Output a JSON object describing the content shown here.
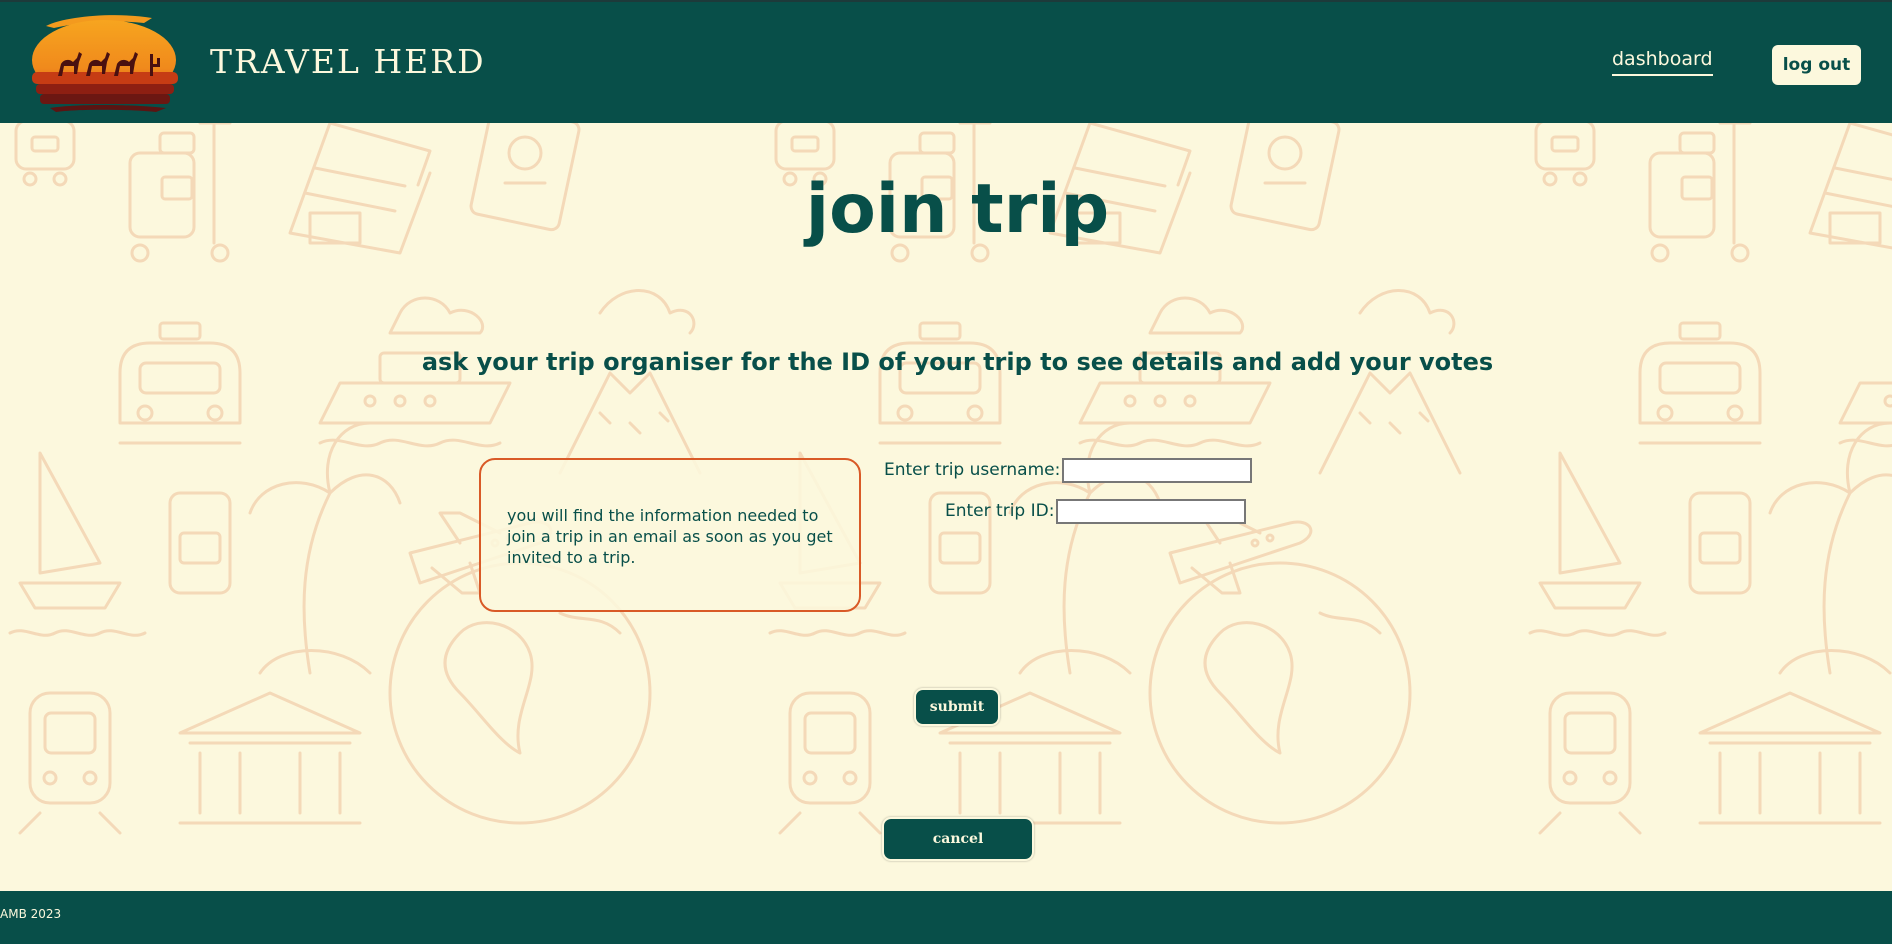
{
  "header": {
    "brand": "TRAVEL HERD",
    "nav_dashboard": "dashboard",
    "logout_label": "log out"
  },
  "main": {
    "title": "join trip",
    "subtitle": "ask your trip organiser for the ID of your trip to see details and add your votes",
    "info_text": "you will find the information needed to join a trip in an email as soon as you get invited to a trip.",
    "fields": {
      "username_label": "Enter trip username:",
      "username_value": "",
      "tripid_label": "Enter trip ID:",
      "tripid_value": ""
    },
    "submit_label": "submit",
    "cancel_label": "cancel"
  },
  "footer": {
    "copyright": "AMB 2023"
  },
  "colors": {
    "primary": "#084f49",
    "background": "#fcf8dd",
    "accent": "#d95a27",
    "pattern": "#f4d9b8"
  },
  "icons": {
    "logo": "sunset-camel-caravan-logo",
    "background_pattern": [
      "luggage-icon",
      "hotel-icon",
      "passport-icon",
      "taxi-icon",
      "cruise-ship-icon",
      "volcano-icon",
      "airplane-icon",
      "palm-tree-icon",
      "sailboat-icon",
      "globe-icon",
      "train-icon",
      "museum-icon"
    ]
  }
}
